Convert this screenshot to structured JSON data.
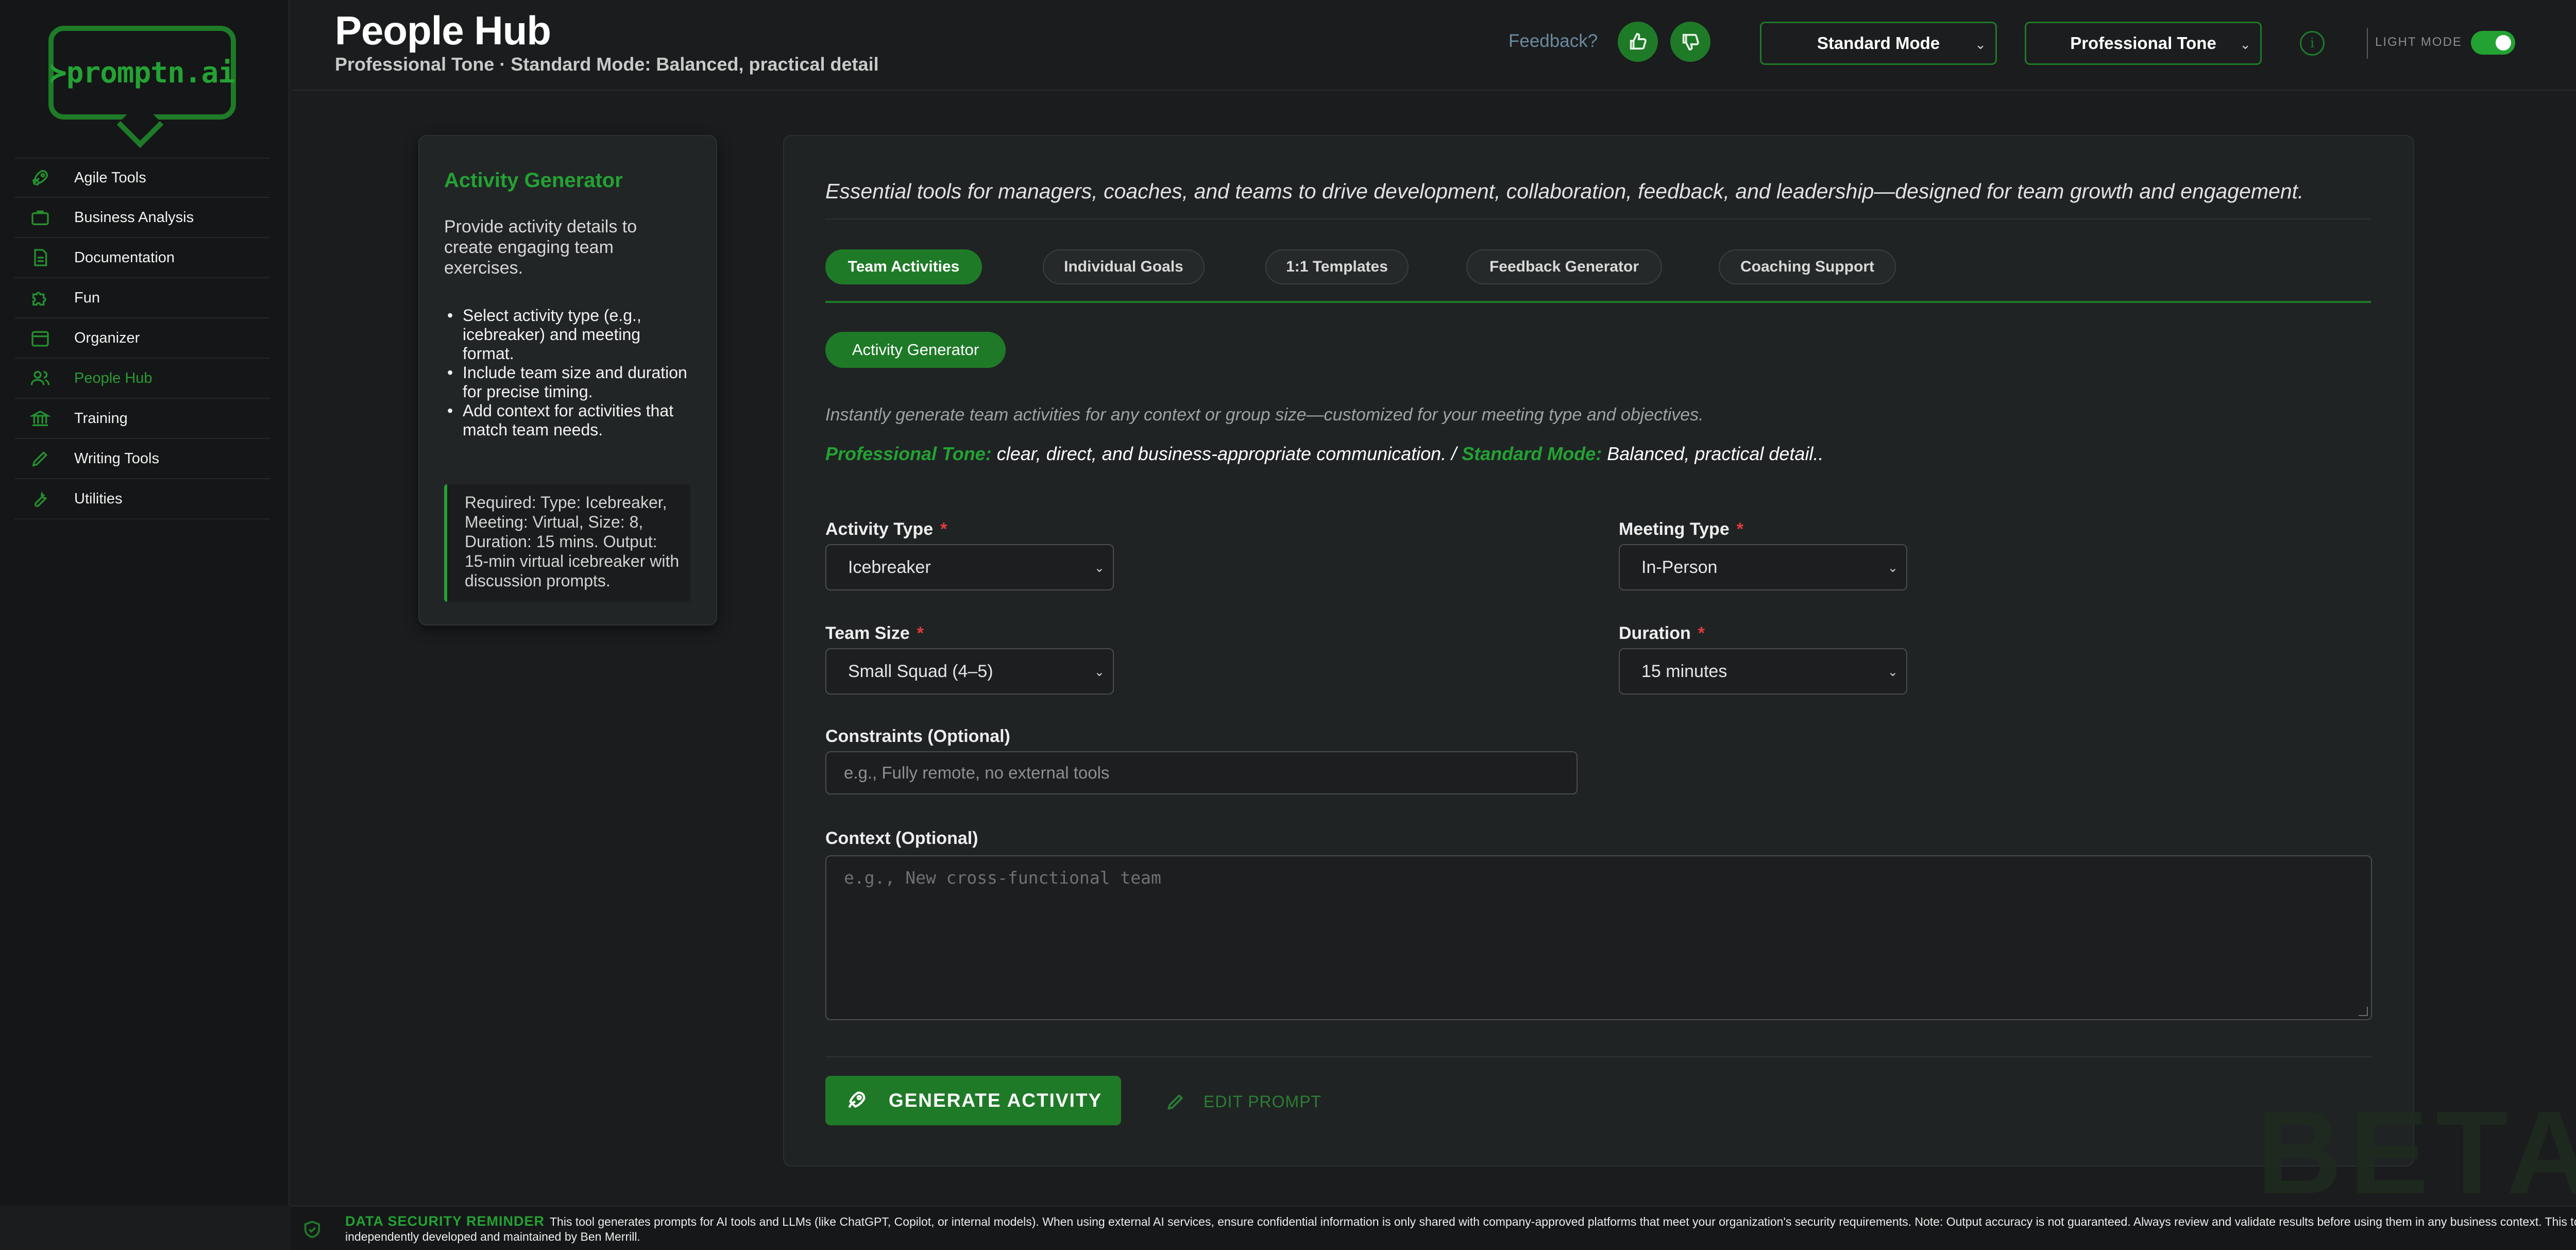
{
  "brand": {
    "logo_text": "≻promptn.ai"
  },
  "sidebar": {
    "items": [
      {
        "label": "Agile Tools",
        "icon": "rocket-icon"
      },
      {
        "label": "Business Analysis",
        "icon": "briefcase-icon"
      },
      {
        "label": "Documentation",
        "icon": "document-icon"
      },
      {
        "label": "Fun",
        "icon": "puzzle-icon"
      },
      {
        "label": "Organizer",
        "icon": "calendar-icon"
      },
      {
        "label": "People Hub",
        "icon": "people-icon",
        "active": true
      },
      {
        "label": "Training",
        "icon": "institution-icon"
      },
      {
        "label": "Writing Tools",
        "icon": "pencil-icon"
      },
      {
        "label": "Utilities",
        "icon": "wrench-icon"
      }
    ]
  },
  "header": {
    "title": "People Hub",
    "subtitle": "Professional Tone · Standard Mode: Balanced, practical detail",
    "feedback_label": "Feedback?",
    "mode_select": "Standard Mode",
    "tone_select": "Professional Tone",
    "info_icon_glyph": "i",
    "light_mode_label": "LIGHT MODE",
    "light_mode_on": true
  },
  "info_card": {
    "title": "Activity Generator",
    "description": "Provide activity details to create engaging team exercises.",
    "bullets": [
      "Select activity type (e.g., icebreaker) and meeting format.",
      "Include team size and duration for precise timing.",
      "Add context for activities that match team needs."
    ],
    "note": "Required: Type: Icebreaker, Meeting: Virtual, Size: 8, Duration: 15 mins. Output: 15-min virtual icebreaker with discussion prompts."
  },
  "main": {
    "tagline": "Essential tools for managers, coaches, and teams to drive development, collaboration, feedback, and leadership—designed for team growth and engagement.",
    "tabs": [
      {
        "label": "Team Activities",
        "active": true
      },
      {
        "label": "Individual Goals"
      },
      {
        "label": "1:1 Templates"
      },
      {
        "label": "Feedback Generator"
      },
      {
        "label": "Coaching Support"
      }
    ],
    "subtab": "Activity Generator",
    "description": "Instantly generate team activities for any context or group size—customized for your meeting type and objectives.",
    "mode_line": {
      "tone_name": "Professional Tone:",
      "tone_desc": " clear, direct, and business-appropriate communication. / ",
      "mode_name": "Standard Mode:",
      "mode_desc": " Balanced, practical detail.."
    },
    "fields": {
      "activity_type": {
        "label": "Activity Type",
        "value": "Icebreaker"
      },
      "meeting_type": {
        "label": "Meeting Type",
        "value": "In-Person"
      },
      "team_size": {
        "label": "Team Size",
        "value": "Small Squad (4–5)"
      },
      "duration": {
        "label": "Duration",
        "value": "15 minutes"
      },
      "constraints": {
        "label": "Constraints (Optional)",
        "placeholder": "e.g., Fully remote, no external tools"
      },
      "context": {
        "label": "Context (Optional)",
        "placeholder": "e.g., New cross-functional team"
      }
    },
    "generate_button": "GENERATE ACTIVITY",
    "edit_button": "EDIT PROMPT"
  },
  "watermark": "BETA",
  "footer": {
    "heading": "DATA SECURITY REMINDER",
    "text": "This tool generates prompts for AI tools and LLMs (like ChatGPT, Copilot, or internal models). When using external AI services, ensure confidential information is only shared with company-approved platforms that meet your organization's security requirements. Note: Output accuracy is not guaranteed. Always review and validate results before using them in any business context. This tool is independently developed and maintained by Ben Merrill."
  },
  "colors": {
    "accent": "#1f7a28",
    "accent_text": "#23a233",
    "background": "#1a1c1d",
    "required": "#e03b3b"
  }
}
